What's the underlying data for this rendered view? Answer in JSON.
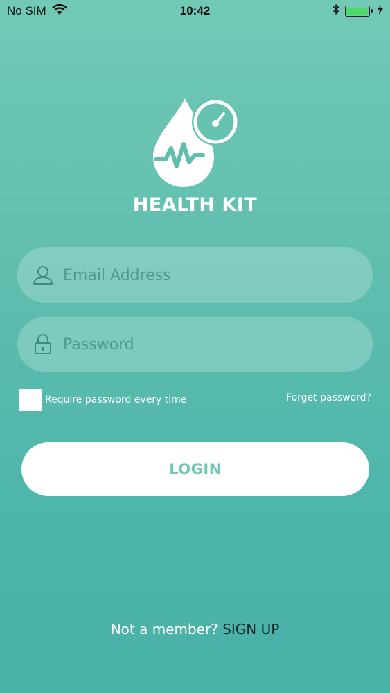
{
  "status_bar": {
    "carrier": "No SIM",
    "time": "10:42",
    "battery_level": 1.0,
    "battery_color": "#4cd964"
  },
  "app": {
    "title": "HEALTH KIT",
    "logo_icon": "water-drop-heartbeat-gauge-icon"
  },
  "form": {
    "email": {
      "placeholder": "Email Address",
      "value": "",
      "icon": "user-icon"
    },
    "password": {
      "placeholder": "Password",
      "value": "",
      "icon": "lock-icon"
    },
    "remember_label": "Require password every time",
    "remember_checked": false,
    "forget_label": "Forget password?",
    "login_label": "LOGIN"
  },
  "footer": {
    "prompt": "Not a member? ",
    "signup_label": "SIGN UP"
  },
  "colors": {
    "background_top": "#72c9b6",
    "background_bottom": "#49b1a8",
    "accent": "#74c7b7",
    "field_text": "#3f8a7e"
  }
}
